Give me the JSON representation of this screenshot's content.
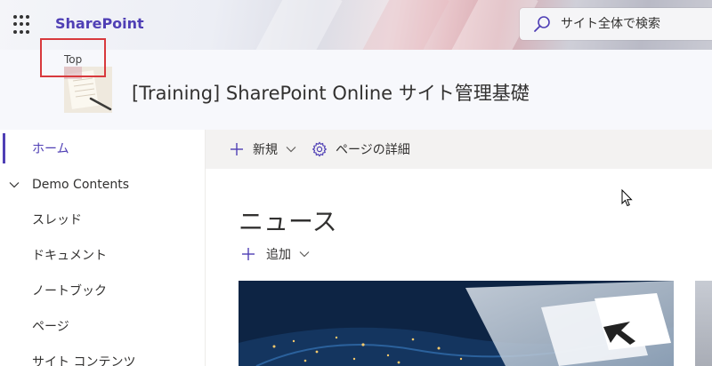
{
  "suitebar": {
    "brand": "SharePoint",
    "search_placeholder": "サイト全体で検索"
  },
  "site": {
    "top_label": "Top",
    "title": "[Training] SharePoint Online サイト管理基礎"
  },
  "leftnav": {
    "items": [
      {
        "label": "ホーム",
        "active": true
      },
      {
        "label": "Demo Contents",
        "expandable": true,
        "expanded": true
      },
      {
        "label": "スレッド"
      },
      {
        "label": "ドキュメント"
      },
      {
        "label": "ノートブック"
      },
      {
        "label": "ページ"
      },
      {
        "label": "サイト コンテンツ"
      }
    ]
  },
  "commandbar": {
    "new_label": "新規",
    "page_details_label": "ページの詳細"
  },
  "news": {
    "title": "ニュース",
    "add_label": "追加"
  },
  "colors": {
    "accent": "#4f3fb5",
    "highlight": "#d8393d",
    "command_bar_bg": "#f3f2f1"
  },
  "icons": [
    "waffle-icon",
    "search-icon",
    "chevron-down-icon",
    "plus-icon",
    "gear-icon",
    "cursor-icon"
  ]
}
